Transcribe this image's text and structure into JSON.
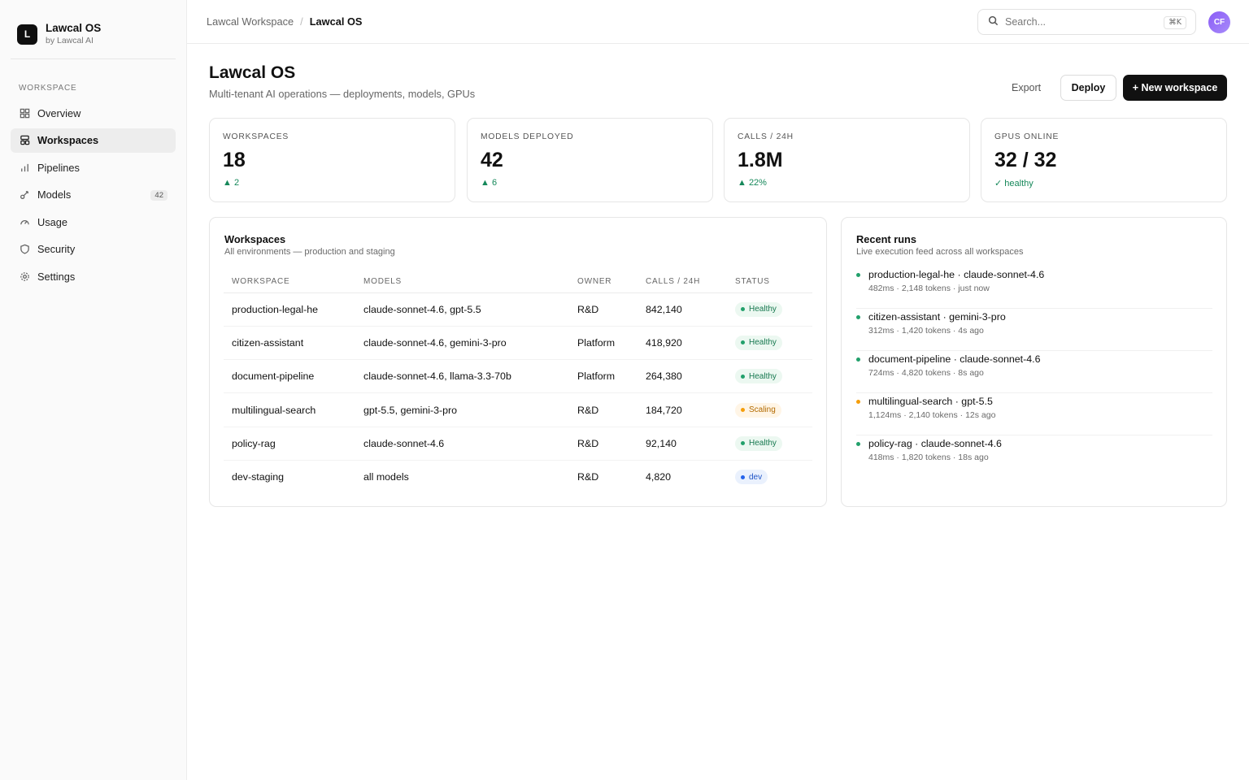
{
  "brand": {
    "logo_letter": "L",
    "name": "Lawcal OS",
    "sub": "by Lawcal AI"
  },
  "sidebar": {
    "section_label": "WORKSPACE",
    "items": [
      {
        "label": "Overview",
        "icon": "grid-icon"
      },
      {
        "label": "Workspaces",
        "icon": "workspaces-icon",
        "active": true
      },
      {
        "label": "Pipelines",
        "icon": "bar-chart-icon"
      },
      {
        "label": "Models",
        "icon": "model-icon",
        "badge": "42"
      },
      {
        "label": "Usage",
        "icon": "gauge-icon"
      },
      {
        "label": "Security",
        "icon": "shield-icon"
      },
      {
        "label": "Settings",
        "icon": "gear-icon"
      }
    ]
  },
  "topbar": {
    "breadcrumb": {
      "parent": "Lawcal Workspace",
      "separator": "/",
      "current": "Lawcal OS"
    },
    "search": {
      "placeholder": "Search...",
      "shortcut": "⌘K"
    },
    "avatar_initials": "CF"
  },
  "header": {
    "title": "Lawcal OS",
    "subtitle": "Multi-tenant AI operations — deployments, models, GPUs",
    "actions": {
      "export": "Export",
      "deploy": "Deploy",
      "new_workspace": "+ New workspace"
    }
  },
  "stats": [
    {
      "label": "WORKSPACES",
      "value": "18",
      "delta": "▲ 2"
    },
    {
      "label": "MODELS DEPLOYED",
      "value": "42",
      "delta": "▲ 6"
    },
    {
      "label": "CALLS / 24H",
      "value": "1.8M",
      "delta": "▲ 22%"
    },
    {
      "label": "GPUS ONLINE",
      "value": "32 / 32",
      "delta": "✓ healthy"
    }
  ],
  "workspaces_panel": {
    "title": "Workspaces",
    "subtitle": "All environments — production and staging",
    "columns": [
      "WORKSPACE",
      "MODELS",
      "OWNER",
      "CALLS / 24H",
      "STATUS"
    ],
    "rows": [
      {
        "workspace": "production-legal-he",
        "models": "claude-sonnet-4.6, gpt-5.5",
        "owner": "R&D",
        "calls": "842,140",
        "status": "Healthy",
        "status_kind": "ok"
      },
      {
        "workspace": "citizen-assistant",
        "models": "claude-sonnet-4.6, gemini-3-pro",
        "owner": "Platform",
        "calls": "418,920",
        "status": "Healthy",
        "status_kind": "ok"
      },
      {
        "workspace": "document-pipeline",
        "models": "claude-sonnet-4.6, llama-3.3-70b",
        "owner": "Platform",
        "calls": "264,380",
        "status": "Healthy",
        "status_kind": "ok"
      },
      {
        "workspace": "multilingual-search",
        "models": "gpt-5.5, gemini-3-pro",
        "owner": "R&D",
        "calls": "184,720",
        "status": "Scaling",
        "status_kind": "warn"
      },
      {
        "workspace": "policy-rag",
        "models": "claude-sonnet-4.6",
        "owner": "R&D",
        "calls": "92,140",
        "status": "Healthy",
        "status_kind": "ok"
      },
      {
        "workspace": "dev-staging",
        "models": "all models",
        "owner": "R&D",
        "calls": "4,820",
        "status": "dev",
        "status_kind": "info"
      }
    ]
  },
  "runs_panel": {
    "title": "Recent runs",
    "subtitle": "Live execution feed across all workspaces",
    "runs": [
      {
        "title": "production-legal-he · claude-sonnet-4.6",
        "meta": "482ms · 2,148 tokens · just now",
        "status_kind": "ok"
      },
      {
        "title": "citizen-assistant · gemini-3-pro",
        "meta": "312ms · 1,420 tokens · 4s ago",
        "status_kind": "ok"
      },
      {
        "title": "document-pipeline · claude-sonnet-4.6",
        "meta": "724ms · 4,820 tokens · 8s ago",
        "status_kind": "ok"
      },
      {
        "title": "multilingual-search · gpt-5.5",
        "meta": "1,124ms · 2,140 tokens · 12s ago",
        "status_kind": "warn"
      },
      {
        "title": "policy-rag · claude-sonnet-4.6",
        "meta": "418ms · 1,820 tokens · 18s ago",
        "status_kind": "ok"
      }
    ]
  },
  "colors": {
    "ok": "#22a06b",
    "warn": "#f59e0b",
    "info": "#2563eb",
    "accent": "#111111",
    "avatar": "#8b5cf6"
  }
}
